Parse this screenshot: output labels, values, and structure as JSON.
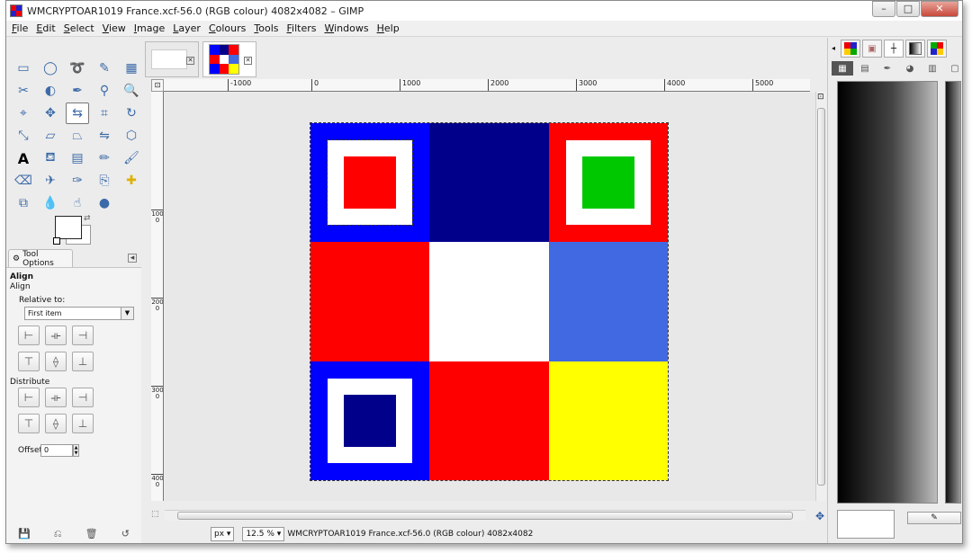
{
  "window": {
    "title": "WMCRYPTOAR1019 France.xcf-56.0 (RGB colour) 4082x4082 – GIMP",
    "controls": {
      "minimize": "–",
      "maximize": "□",
      "close": "✕"
    }
  },
  "menu": [
    "File",
    "Edit",
    "Select",
    "View",
    "Image",
    "Layer",
    "Colours",
    "Tools",
    "Filters",
    "Windows",
    "Help"
  ],
  "tool_options": {
    "tab_label": "Tool Options",
    "tool_name": "Align",
    "tool_subtitle": "Align",
    "relative_to_label": "Relative to:",
    "relative_to_value": "First item",
    "distribute_label": "Distribute",
    "offset_label": "Offset:",
    "offset_value": "0"
  },
  "ruler": {
    "h_labels": [
      "-1000",
      "0",
      "1000",
      "2000",
      "3000",
      "4000",
      "5000"
    ],
    "v_labels": [
      "1000",
      "2000",
      "3000",
      "4000"
    ]
  },
  "status": {
    "unit": "px",
    "zoom": "12.5 %",
    "info": "WMCRYPTOAR1019 France.xcf-56.0 (RGB colour) 4082x4082"
  },
  "image_grid": {
    "colors": {
      "blue": "#0000ff",
      "navy": "#00008b",
      "red": "#ff0000",
      "white": "#ffffff",
      "royal_blue": "#4169e1",
      "yellow": "#ffff00",
      "green": "#00c800"
    }
  }
}
